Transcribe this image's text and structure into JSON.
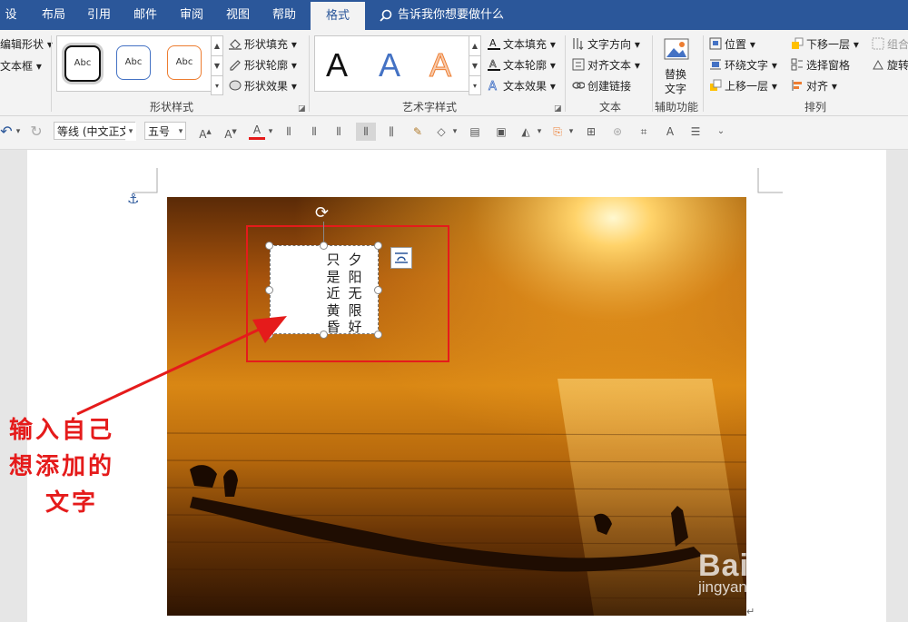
{
  "tabs": [
    "设计",
    "布局",
    "引用",
    "邮件",
    "审阅",
    "视图",
    "帮助",
    "格式"
  ],
  "tell_me": "告诉我你想要做什么",
  "ribbon": {
    "left_items": [
      "编辑形状",
      "文本框"
    ],
    "shape_gallery": [
      "Abc",
      "Abc",
      "Abc"
    ],
    "shape_cmds": [
      "形状填充",
      "形状轮廓",
      "形状效果"
    ],
    "shape_group": "形状样式",
    "wordart_letters": [
      "A",
      "A",
      "A"
    ],
    "wordart_cmds": [
      "文本填充",
      "文本轮廓",
      "文本效果"
    ],
    "wordart_group": "艺术字样式",
    "text_cmds": [
      "文字方向",
      "对齐文本",
      "创建链接"
    ],
    "text_group": "文本",
    "alt_text": "替换\n文字",
    "alt_text_l1": "替换",
    "alt_text_l2": "文字",
    "access_group": "辅助功能",
    "arrange_col1": [
      "位置",
      "环绕文字",
      "上移一层"
    ],
    "arrange_col2": [
      "下移一层",
      "选择窗格",
      "对齐"
    ],
    "arrange_col3": [
      "组合",
      "旋转"
    ],
    "arrange_group": "排列"
  },
  "qat": {
    "font": "等线 (中文正文)",
    "size": "五号"
  },
  "textbox": {
    "col_right": "夕阳无限好",
    "col_left": "只是近黄昏"
  },
  "annotation": [
    "输入自己",
    "想添加的",
    "文字"
  ],
  "watermark": {
    "brand": "Baidu 经验",
    "url": "jingyan.baidu.com"
  },
  "colors": {
    "tab_blue": "#2b579a",
    "annotation_red": "#e51b1b"
  }
}
